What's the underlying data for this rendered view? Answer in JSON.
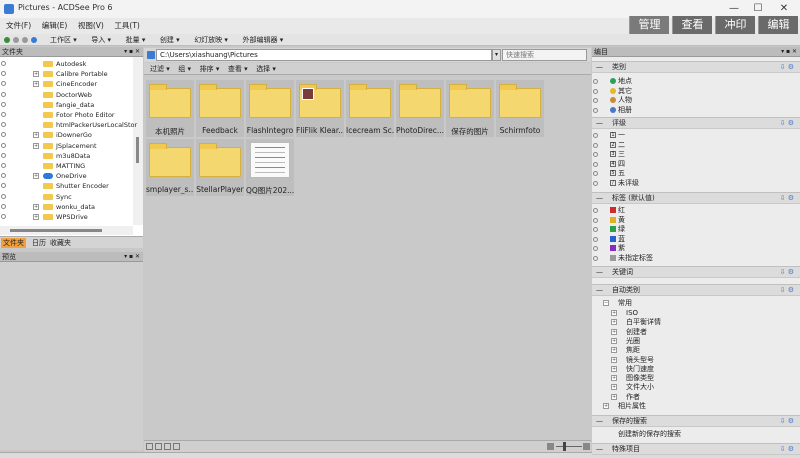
{
  "app": {
    "title": "Pictures - ACDSee Pro 6",
    "win_min": "—",
    "win_max": "☐",
    "win_close": "✕"
  },
  "menu": [
    "文件(F)",
    "编辑(E)",
    "视图(V)",
    "工具(T)"
  ],
  "modes": [
    "管理",
    "查看",
    "冲印",
    "编辑"
  ],
  "toolbar": [
    "工作区 ▾",
    "导入 ▾",
    "批量 ▾",
    "创建 ▾",
    "幻灯放映 ▾",
    "外部编辑器 ▾"
  ],
  "folders": {
    "title": "文件夹",
    "items": [
      {
        "label": "Autodesk",
        "expand": false,
        "blue": false
      },
      {
        "label": "Calibre Portable",
        "expand": true,
        "blue": false
      },
      {
        "label": "CineEncoder",
        "expand": true,
        "blue": false
      },
      {
        "label": "DoctorWeb",
        "expand": false,
        "blue": false
      },
      {
        "label": "fangie_data",
        "expand": false,
        "blue": false
      },
      {
        "label": "Fotor Photo Editor",
        "expand": false,
        "blue": false
      },
      {
        "label": "htmlPackerUserLocalStor",
        "expand": false,
        "blue": false
      },
      {
        "label": "iDownerGo",
        "expand": true,
        "blue": false
      },
      {
        "label": "JSplacement",
        "expand": true,
        "blue": false
      },
      {
        "label": "m3u8Data",
        "expand": false,
        "blue": false
      },
      {
        "label": "MATTING",
        "expand": false,
        "blue": false
      },
      {
        "label": "OneDrive",
        "expand": true,
        "blue": true
      },
      {
        "label": "Shutter Encoder",
        "expand": false,
        "blue": false
      },
      {
        "label": "Sync",
        "expand": false,
        "blue": false
      },
      {
        "label": "wonku_data",
        "expand": true,
        "blue": false
      },
      {
        "label": "WPSDrive",
        "expand": true,
        "blue": false
      }
    ],
    "tabs": [
      "文件夹",
      "日历",
      "收藏夹"
    ]
  },
  "preview": {
    "title": "预览"
  },
  "path": "C:\\Users\\xiashuang\\Pictures",
  "search_placeholder": "快速搜索",
  "filterbar": [
    "过滤 ▾",
    "组 ▾",
    "排序 ▾",
    "查看 ▾",
    "选择 ▾"
  ],
  "thumbnails": [
    {
      "label": "本机照片",
      "kind": "folder"
    },
    {
      "label": "Feedback",
      "kind": "folder"
    },
    {
      "label": "FlashIntegro",
      "kind": "folder"
    },
    {
      "label": "FliFlik Klear...",
      "kind": "folder-avatar"
    },
    {
      "label": "Icecream Sc...",
      "kind": "folder"
    },
    {
      "label": "PhotoDirec...",
      "kind": "folder"
    },
    {
      "label": "保存的图片",
      "kind": "folder"
    },
    {
      "label": "Schirmfoto",
      "kind": "folder"
    },
    {
      "label": "smplayer_s...",
      "kind": "folder"
    },
    {
      "label": "StellarPlayer",
      "kind": "folder"
    },
    {
      "label": "QQ图片202...",
      "kind": "document"
    }
  ],
  "right_panel": {
    "title": "编目",
    "category_title": "类别",
    "categories": [
      {
        "label": "地点",
        "color": "#2aa05a"
      },
      {
        "label": "其它",
        "color": "#e3b82a"
      },
      {
        "label": "人物",
        "color": "#c98a3b"
      },
      {
        "label": "相册",
        "color": "#4a78c8"
      }
    ],
    "rating_title": "评级",
    "ratings": [
      {
        "num": "1",
        "label": "一"
      },
      {
        "num": "2",
        "label": "二"
      },
      {
        "num": "3",
        "label": "三"
      },
      {
        "num": "4",
        "label": "四"
      },
      {
        "num": "5",
        "label": "五"
      },
      {
        "num": "/",
        "label": "未评级"
      }
    ],
    "label_title": "标签 (默认值)",
    "labels": [
      {
        "label": "红",
        "color": "#d02b2b"
      },
      {
        "label": "黄",
        "color": "#e0b020"
      },
      {
        "label": "绿",
        "color": "#2aa04a"
      },
      {
        "label": "蓝",
        "color": "#2b5ed0"
      },
      {
        "label": "紫",
        "color": "#8a2bc0"
      },
      {
        "label": "未指定标签",
        "color": "#9a9a9a"
      }
    ],
    "keyword_title": "关键词",
    "auto_title": "自动类别",
    "auto_common": "常用",
    "auto_items": [
      "ISO",
      "白平衡详情",
      "创建者",
      "光圈",
      "焦距",
      "镜头型号",
      "快门速度",
      "图像类型",
      "文件大小",
      "作者"
    ],
    "auto_photo": "相片属性",
    "saved_title": "保存的搜索",
    "saved_item": "创建新的保存的搜索",
    "special_title": "特殊项目"
  }
}
